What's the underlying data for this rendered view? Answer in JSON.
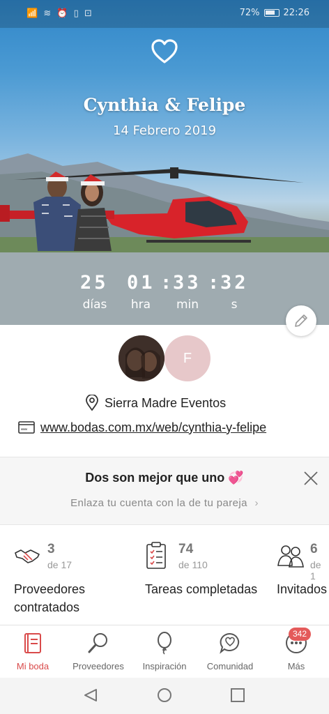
{
  "status_bar": {
    "indicators": "📶 ≋ ⏰ ▯ ⊡",
    "battery_percent": "72%",
    "time": "22:26"
  },
  "hero": {
    "icon": "heart-outline-icon",
    "names": "Cynthia & Felipe",
    "date": "14 Febrero 2019",
    "countdown": {
      "days_value": "25",
      "hours_value": "01",
      "minutes_value": "33",
      "seconds_value": "32",
      "separator": ":",
      "days_label": "días",
      "hours_label": "hra",
      "minutes_label": "min",
      "seconds_label": "s"
    }
  },
  "profile": {
    "partner_initial": "F",
    "venue": "Sierra Madre Eventos",
    "website": "www.bodas.com.mx/web/cynthia-y-felipe"
  },
  "partner_banner": {
    "title": "Dos son mejor que uno 💞",
    "subtitle": "Enlaza tu cuenta con la de tu pareja",
    "chevron": "›"
  },
  "stats": [
    {
      "icon": "handshake-icon",
      "value": "3",
      "total": "de 17",
      "label": "Proveedores contratados"
    },
    {
      "icon": "clipboard-checklist-icon",
      "value": "74",
      "total": "de 110",
      "label": "Tareas completadas"
    },
    {
      "icon": "guests-icon",
      "value": "6",
      "total": "de 1",
      "label": "Invitados confirma"
    }
  ],
  "tab_bar": {
    "tabs": [
      {
        "label": "Mi boda",
        "icon": "notebook-icon",
        "active": true
      },
      {
        "label": "Proveedores",
        "icon": "magnifier-icon",
        "active": false
      },
      {
        "label": "Inspiración",
        "icon": "balloon-icon",
        "active": false
      },
      {
        "label": "Comunidad",
        "icon": "chat-heart-icon",
        "active": false
      },
      {
        "label": "Más",
        "icon": "more-dots-icon",
        "active": false
      }
    ],
    "more_badge": "342"
  },
  "colors": {
    "accent": "#d94a4a",
    "badge": "#e45a5a",
    "countdown_band": "#9fabb0",
    "partner_avatar": "#e7c8ca"
  }
}
